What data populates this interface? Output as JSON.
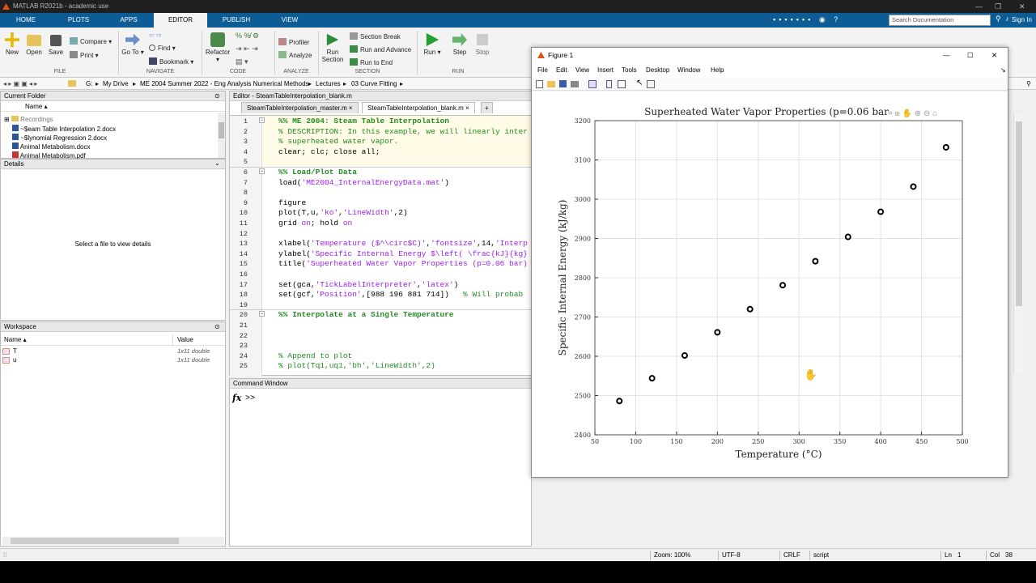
{
  "app": {
    "title": "MATLAB R2021b - academic use"
  },
  "ribbon_tabs": [
    "HOME",
    "PLOTS",
    "APPS",
    "EDITOR",
    "PUBLISH",
    "VIEW"
  ],
  "active_tab": "EDITOR",
  "search": {
    "placeholder": "Search Documentation"
  },
  "sign_in": "Sign In",
  "toolstrip": {
    "new": "New",
    "open": "Open",
    "save": "Save",
    "compare": "Compare",
    "print": "Print",
    "goto": "Go To",
    "find": "Find",
    "bookmark": "Bookmark",
    "refactor": "Refactor",
    "profiler": "Profiler",
    "analyze": "Analyze",
    "run_section": "Run Section",
    "section_break": "Section Break",
    "run_and_advance": "Run and Advance",
    "run_to_end": "Run to End",
    "run": "Run",
    "step": "Step",
    "stop": "Stop",
    "sections": {
      "file": "FILE",
      "navigate": "NAVIGATE",
      "code": "CODE",
      "analyze": "ANALYZE",
      "section": "SECTION",
      "run": "RUN"
    }
  },
  "address": {
    "drive": "G:",
    "path": [
      "My Drive",
      "ME 2004 Summer 2022 - Eng Analysis Numerical Methods",
      "Lectures",
      "03 Curve Fitting"
    ]
  },
  "current_folder": {
    "title": "Current Folder",
    "col": "Name ▴",
    "items": [
      "Recordings",
      "~$eam Table Interpolation 2.docx",
      "~$lynomial Regression 2.docx",
      "Animal Metabolism.docx",
      "Animal Metabolism.pdf"
    ]
  },
  "details": {
    "title": "Details",
    "message": "Select a file to view details"
  },
  "workspace": {
    "title": "Workspace",
    "col_name": "Name ▴",
    "col_value": "Value",
    "vars": [
      {
        "name": "T",
        "value": "1x11 double"
      },
      {
        "name": "u",
        "value": "1x11 double"
      }
    ]
  },
  "editor": {
    "title": "Editor - SteamTableInterpolation_blank.m",
    "tabs": [
      "SteamTableInterpolation_master.m",
      "SteamTableInterpolation_blank.m"
    ],
    "lines": [
      "%% ME 2004: Steam Table Interpolation",
      "% DESCRIPTION: In this example, we will linearly inter",
      "% superheated water vapor.",
      "clear; clc; close all;",
      "",
      "%% Load/Plot Data",
      "load('ME2004_InternalEnergyData.mat')",
      "",
      "figure",
      "plot(T,u,'ko','LineWidth',2)",
      "grid on; hold on",
      "",
      "xlabel('Temperature ($^\\circ$C)','fontsize',14,'Interp",
      "ylabel('Specific Internal Energy $\\left( \\frac{kJ}{kg}",
      "title('Superheated Water Vapor Properties (p=0.06 bar)",
      "",
      "set(gca,'TickLabelInterpreter','latex')",
      "set(gcf,'Position',[988 196 881 714])   % Will probab",
      "",
      "%% Interpolate at a Single Temperature",
      "",
      "",
      "",
      "% Append to plot",
      "% plot(Tq1,uq1,'bh','LineWidth',2)"
    ]
  },
  "command_window": {
    "title": "Command Window",
    "prompt": ">>"
  },
  "status": {
    "zoom": "Zoom: 100%",
    "encoding": "UTF-8",
    "eol": "CRLF",
    "type": "script",
    "ln_label": "Ln",
    "ln": "1",
    "col_label": "Col",
    "col": "38"
  },
  "figure": {
    "title": "Figure 1",
    "menu": [
      "File",
      "Edit",
      "View",
      "Insert",
      "Tools",
      "Desktop",
      "Window",
      "Help"
    ]
  },
  "chart_data": {
    "type": "scatter",
    "title": "Superheated Water Vapor Properties (p=0.06 bar",
    "xlabel": "Temperature (°C)",
    "ylabel": "Specific Internal Energy (kJ/kg)",
    "xlim": [
      50,
      500
    ],
    "ylim": [
      2400,
      3200
    ],
    "xticks": [
      50,
      100,
      150,
      200,
      250,
      300,
      350,
      400,
      450,
      500
    ],
    "yticks": [
      2400,
      2500,
      2600,
      2700,
      2800,
      2900,
      3000,
      3100,
      3200
    ],
    "grid": true,
    "marker": "ko",
    "x": [
      80,
      120,
      160,
      200,
      240,
      280,
      320,
      360,
      400,
      440,
      480
    ],
    "y": [
      2486,
      2544,
      2602,
      2661,
      2720,
      2781,
      2842,
      2904,
      2968,
      3032,
      3132
    ]
  }
}
